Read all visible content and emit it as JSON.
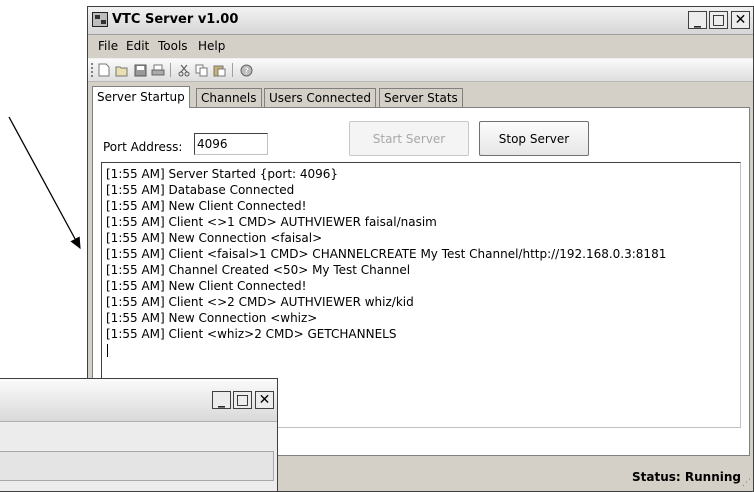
{
  "window": {
    "title": "VTC Server v1.00",
    "controls": {
      "minimize": "_",
      "maximize": "□",
      "close": "✕"
    }
  },
  "menu": [
    "File",
    "Edit",
    "Tools",
    "Help"
  ],
  "toolbar": [
    "new-icon",
    "open-icon",
    "save-icon",
    "print-icon",
    "cut-icon",
    "copy-icon",
    "paste-icon",
    "help-icon"
  ],
  "tabs": [
    "Server Startup",
    "Channels",
    "Users Connected",
    "Server Stats"
  ],
  "startup": {
    "port_label": "Port Address:",
    "port_value": "4096",
    "start_button": "Start Server",
    "stop_button": "Stop Server"
  },
  "log": [
    "[1:55 AM] Server Started {port: 4096}",
    "[1:55 AM] Database Connected",
    "[1:55 AM] New Client Connected!",
    "[1:55 AM] Client <>1 CMD> AUTHVIEWER faisal/nasim",
    "[1:55 AM] New Connection <faisal>",
    "[1:55 AM] Client <faisal>1 CMD> CHANNELCREATE My Test Channel/http://192.168.0.3:8181",
    "[1:55 AM] Channel Created <50> My Test Channel",
    "[1:55 AM] New Client Connected!",
    "[1:55 AM] Client <>2 CMD> AUTHVIEWER whiz/kid",
    "[1:55 AM] New Connection <whiz>",
    "[1:55 AM] Client <whiz>2 CMD> GETCHANNELS"
  ],
  "status": "Status: Running",
  "second_window": {
    "controls": {
      "minimize": "_",
      "maximize": "□",
      "close": "✕"
    }
  }
}
